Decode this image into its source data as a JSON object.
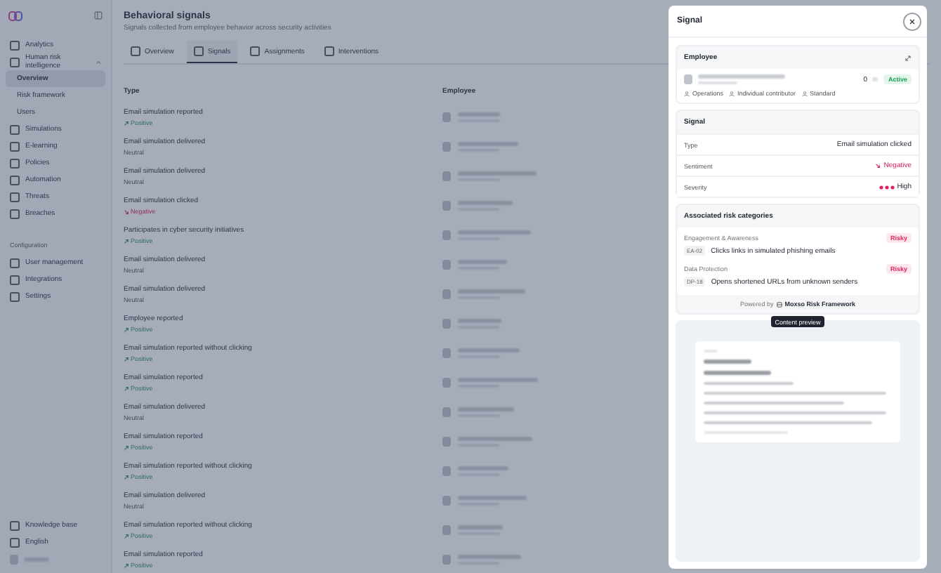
{
  "sidebar": {
    "items": [
      {
        "label": "Analytics",
        "selected": false
      },
      {
        "label": "Human risk intelligence",
        "selected": false,
        "expanded": true,
        "children": [
          {
            "label": "Overview",
            "selected": true
          },
          {
            "label": "Risk framework",
            "selected": false
          },
          {
            "label": "Users",
            "selected": false
          }
        ]
      },
      {
        "label": "Simulations",
        "selected": false
      },
      {
        "label": "E-learning",
        "selected": false
      },
      {
        "label": "Policies",
        "selected": false
      },
      {
        "label": "Automation",
        "selected": false
      },
      {
        "label": "Threats",
        "selected": false
      },
      {
        "label": "Breaches",
        "selected": false
      }
    ],
    "section": "Configuration",
    "config_items": [
      {
        "label": "User management",
        "selected": false
      },
      {
        "label": "Integrations",
        "selected": false
      },
      {
        "label": "Settings",
        "selected": false
      }
    ],
    "footer_items": [
      {
        "label": "Knowledge base"
      },
      {
        "label": "English"
      }
    ]
  },
  "page": {
    "title": "Behavioral signals",
    "subtitle": "Signals collected from employee behavior across security activities",
    "tabs": [
      {
        "label": "Overview",
        "selected": false
      },
      {
        "label": "Signals",
        "selected": true
      },
      {
        "label": "Assignments",
        "selected": false
      },
      {
        "label": "Interventions",
        "selected": false
      }
    ],
    "columns": [
      "Type",
      "Employee"
    ],
    "rows": [
      {
        "type": "Email simulation reported",
        "sentiment": "Positive",
        "kind": "positive"
      },
      {
        "type": "Email simulation delivered",
        "sentiment": "Neutral",
        "kind": "neutral"
      },
      {
        "type": "Email simulation delivered",
        "sentiment": "Neutral",
        "kind": "neutral"
      },
      {
        "type": "Email simulation clicked",
        "sentiment": "Negative",
        "kind": "negative"
      },
      {
        "type": "Participates in cyber security initiatives",
        "sentiment": "Positive",
        "kind": "positive"
      },
      {
        "type": "Email simulation delivered",
        "sentiment": "Neutral",
        "kind": "neutral"
      },
      {
        "type": "Email simulation delivered",
        "sentiment": "Neutral",
        "kind": "neutral"
      },
      {
        "type": "Employee reported",
        "sentiment": "Positive",
        "kind": "positive"
      },
      {
        "type": "Email simulation reported without clicking",
        "sentiment": "Positive",
        "kind": "positive"
      },
      {
        "type": "Email simulation reported",
        "sentiment": "Positive",
        "kind": "positive"
      },
      {
        "type": "Email simulation delivered",
        "sentiment": "Neutral",
        "kind": "neutral"
      },
      {
        "type": "Email simulation reported",
        "sentiment": "Positive",
        "kind": "positive"
      },
      {
        "type": "Email simulation reported without clicking",
        "sentiment": "Positive",
        "kind": "positive"
      },
      {
        "type": "Email simulation delivered",
        "sentiment": "Neutral",
        "kind": "neutral"
      },
      {
        "type": "Email simulation reported without clicking",
        "sentiment": "Positive",
        "kind": "positive"
      },
      {
        "type": "Email simulation reported",
        "sentiment": "Positive",
        "kind": "positive"
      }
    ]
  },
  "panel": {
    "title": "Signal",
    "employee": {
      "title": "Employee",
      "count": "0",
      "status": "Active",
      "tags": [
        "Operations",
        "Individual contributor",
        "Standard"
      ]
    },
    "signal": {
      "title": "Signal",
      "fields": [
        {
          "label": "Type",
          "value": "Email simulation clicked",
          "kind": "text"
        },
        {
          "label": "Sentiment",
          "value": "Negative",
          "kind": "negative"
        },
        {
          "label": "Severity",
          "value": "High",
          "kind": "severity"
        }
      ]
    },
    "risk": {
      "title": "Associated risk categories",
      "items": [
        {
          "group": "Engagement & Awareness",
          "code": "EA-02",
          "description": "Clicks links in simulated phishing emails",
          "badge": "Risky"
        },
        {
          "group": "Data Protection",
          "code": "DP-18",
          "description": "Opens shortened URLs from unknown senders",
          "badge": "Risky"
        }
      ],
      "powered_by": "Powered by",
      "framework": "Moxso Risk Framework"
    },
    "preview": {
      "label": "Content preview"
    }
  }
}
